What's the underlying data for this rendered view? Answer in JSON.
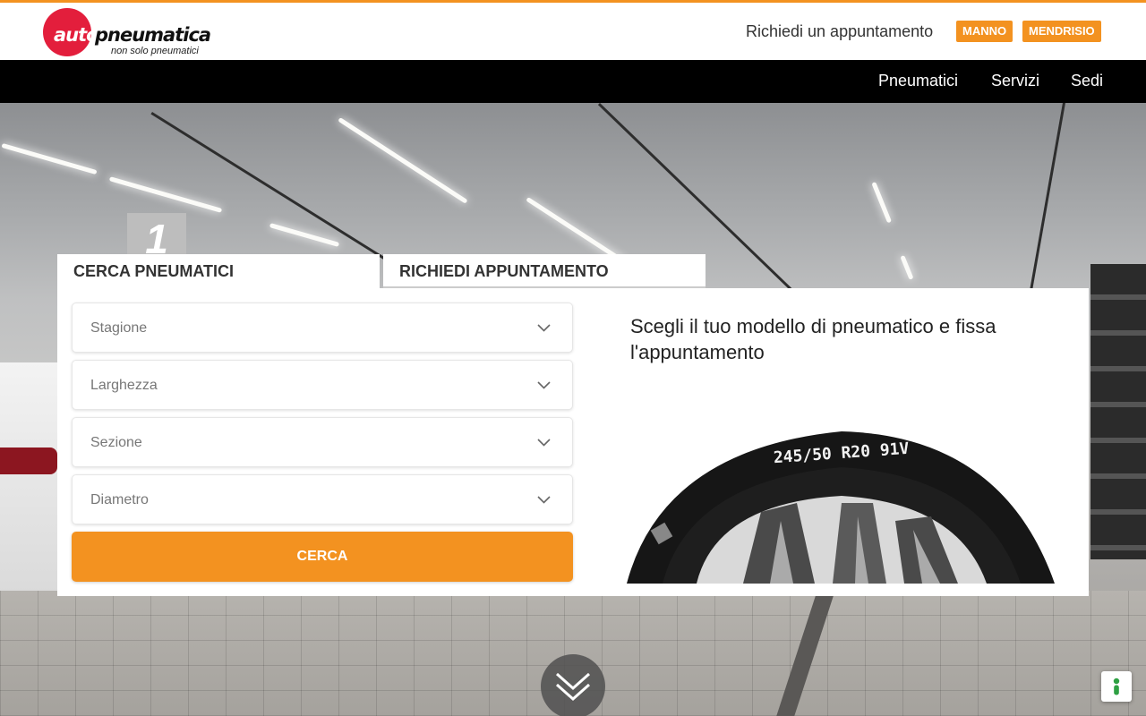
{
  "logo": {
    "part1": "auto",
    "part2": "pneumatica",
    "tagline": "non solo pneumatici"
  },
  "header": {
    "appointment_link": "Richiedi un appuntamento",
    "locations": [
      "MANNO",
      "MENDRISIO"
    ]
  },
  "nav": {
    "items": [
      "Pneumatici",
      "Servizi",
      "Sedi"
    ]
  },
  "hero": {
    "step_badge": "1"
  },
  "tabs": {
    "search": "CERCA PNEUMATICI",
    "appointment": "RICHIEDI APPUNTAMENTO"
  },
  "form": {
    "fields": [
      {
        "label": "Stagione"
      },
      {
        "label": "Larghezza"
      },
      {
        "label": "Sezione"
      },
      {
        "label": "Diametro"
      }
    ],
    "submit": "CERCA"
  },
  "promo": {
    "title": "Scegli il tuo modello di pneumatico e fissa l'appuntamento",
    "tire_marking": "245/50 R20 91V"
  },
  "colors": {
    "accent": "#f39220",
    "logo_red": "#e31e3c",
    "nav_bg": "#000000"
  },
  "icons": {
    "chevron": "chevron-down-icon",
    "scroll": "double-chevron-down-icon",
    "help": "accessibility-icon"
  }
}
